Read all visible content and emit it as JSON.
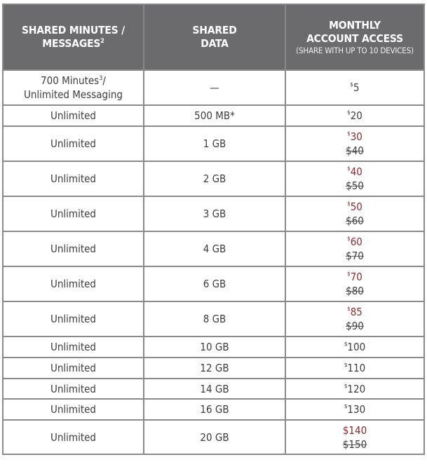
{
  "table": {
    "headers": [
      {
        "label": "SHARED MINUTES /",
        "label2": "MESSAGES",
        "sup": "2"
      },
      {
        "label": "SHARED",
        "label2": "DATA"
      },
      {
        "label": "MONTHLY",
        "label2": "ACCOUNT ACCESS",
        "sub": "(SHARE WITH UP TO 10 DEVICES)"
      }
    ],
    "accent_color": "#8b2a2f",
    "header_color": "#6b6b6d",
    "rows": [
      {
        "minutes": "700 Minutes",
        "minutes_sup": "3",
        "minutes_line2": "Unlimited Messaging",
        "data": "—",
        "price_symbol": "$",
        "price": "5"
      },
      {
        "minutes": "Unlimited",
        "data": "500 MB*",
        "price_symbol": "$",
        "price": "20"
      },
      {
        "minutes": "Unlimited",
        "data": "1 GB",
        "price_symbol": "$",
        "price": "30",
        "old_price": "$40"
      },
      {
        "minutes": "Unlimited",
        "data": "2 GB",
        "price_symbol": "$",
        "price": "40",
        "old_price": "$50"
      },
      {
        "minutes": "Unlimited",
        "data": "3 GB",
        "price_symbol": "$",
        "price": "50",
        "old_price": "$60"
      },
      {
        "minutes": "Unlimited",
        "data": "4 GB",
        "price_symbol": "$",
        "price": "60",
        "old_price": "$70"
      },
      {
        "minutes": "Unlimited",
        "data": "6 GB",
        "price_symbol": "$",
        "price": "70",
        "old_price": "$80"
      },
      {
        "minutes": "Unlimited",
        "data": "8 GB",
        "price_symbol": "$",
        "price": "85",
        "old_price": "$90"
      },
      {
        "minutes": "Unlimited",
        "data": "10 GB",
        "price_symbol": "$",
        "price": "100"
      },
      {
        "minutes": "Unlimited",
        "data": "12 GB",
        "price_symbol": "$",
        "price": "110"
      },
      {
        "minutes": "Unlimited",
        "data": "14 GB",
        "price_symbol": "$",
        "price": "120"
      },
      {
        "minutes": "Unlimited",
        "data": "16 GB",
        "price_symbol": "$",
        "price": "130"
      },
      {
        "minutes": "Unlimited",
        "data": "20 GB",
        "price_full": "$140",
        "old_price": "$150"
      }
    ]
  }
}
